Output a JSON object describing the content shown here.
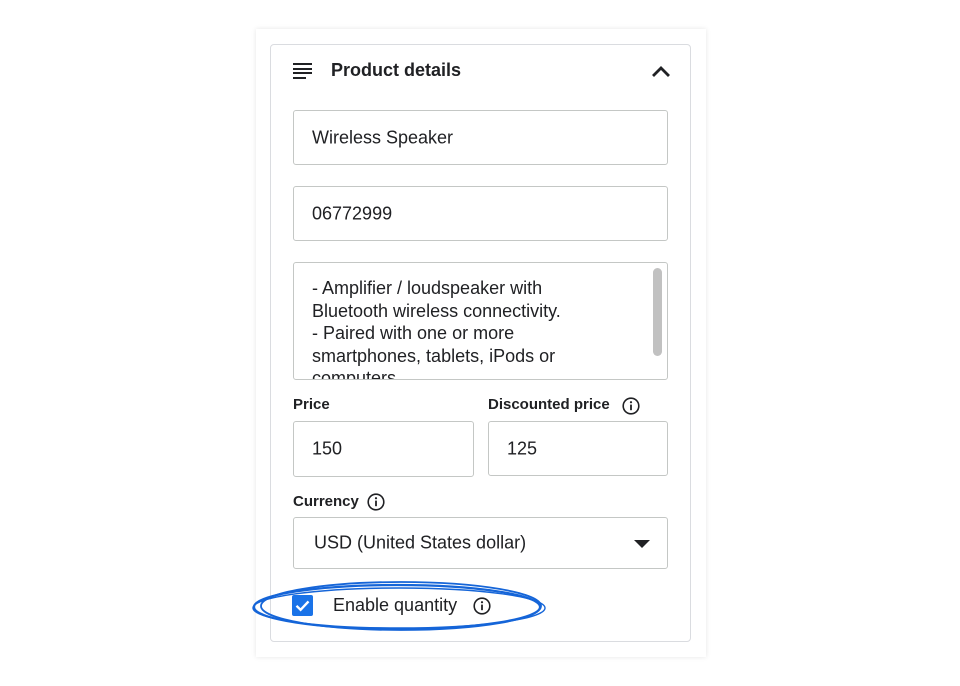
{
  "panel": {
    "title": "Product details",
    "menu_icon": "menu-lines-icon",
    "collapse_icon": "chevron-up-icon"
  },
  "fields": {
    "product_name": "Wireless Speaker",
    "product_code": "06772999",
    "description": "- Amplifier / loudspeaker with\nBluetooth wireless connectivity.\n- Paired with one or more\nsmartphones, tablets, iPods or\ncomputers.",
    "price_label": "Price",
    "price_value": "150",
    "discounted_label": "Discounted price",
    "discounted_value": "125",
    "currency_label": "Currency",
    "currency_value": "USD (United States dollar)"
  },
  "enable_quantity": {
    "label": "Enable quantity",
    "checked": true
  },
  "colors": {
    "accent": "#1a73e8",
    "border": "#c4c7c5",
    "text": "#202124"
  }
}
